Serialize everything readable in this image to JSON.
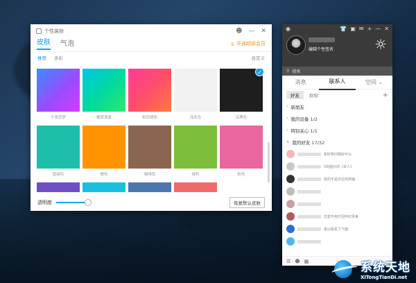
{
  "skin_window": {
    "title": "个性装扮",
    "tabs": [
      {
        "label": "皮肤",
        "active": true
      },
      {
        "label": "气泡",
        "active": false
      }
    ],
    "vip_label": "开通超级会员",
    "subtabs": [
      {
        "label": "推荐",
        "active": true
      },
      {
        "label": "多彩",
        "active": false
      }
    ],
    "custom_label": "自定义",
    "swatches": [
      {
        "label": "千夜恋梦",
        "color": "linear-gradient(135deg,#3b8cff 0%,#9a4bff 55%,#d33cff 100%)",
        "selected": false
      },
      {
        "label": "樱草清香",
        "color": "linear-gradient(135deg,#00c6e6 0%,#00d9a0 50%,#2ee86a 100%)",
        "selected": false
      },
      {
        "label": "粉目晴阳",
        "color": "linear-gradient(135deg,#ff3d9a 0%,#ff4d6a 50%,#ff7a3d 100%)",
        "selected": false
      },
      {
        "label": "浅灰色",
        "color": "#f2f2f2",
        "selected": false
      },
      {
        "label": "深黑色",
        "color": "#1e1e1e",
        "selected": true
      },
      {
        "label": "蓝绿色",
        "color": "#1dbfa9",
        "selected": false
      },
      {
        "label": "橙色",
        "color": "#ff9300",
        "selected": false
      },
      {
        "label": "咖啡色",
        "color": "#8a6650",
        "selected": false
      },
      {
        "label": "绿色",
        "color": "#7dbf3c",
        "selected": false
      },
      {
        "label": "粉色",
        "color": "#e8679e",
        "selected": false
      },
      {
        "label": "",
        "color": "#6e4fc4",
        "selected": false
      },
      {
        "label": "",
        "color": "#18bfe0",
        "selected": false
      },
      {
        "label": "",
        "color": "#4a77b0",
        "selected": false
      },
      {
        "label": "",
        "color": "#f06a6a",
        "selected": false
      }
    ],
    "opacity_label": "透明度",
    "opacity_level": 1.0,
    "reset_label": "恢复默认皮肤"
  },
  "qq_panel": {
    "signature": "编辑个性签名",
    "search_placeholder": "搜索",
    "tabs": [
      {
        "label": "消息",
        "active": false
      },
      {
        "label": "联系人",
        "active": true
      },
      {
        "label": "空间",
        "active": false
      }
    ],
    "subtabs": [
      {
        "label": "好友",
        "active": true
      },
      {
        "label": "群聊",
        "active": false
      }
    ],
    "groups": [
      {
        "label": "新朋友"
      },
      {
        "label": "我的设备 1/2"
      },
      {
        "label": "特别关心 1/1"
      },
      {
        "label": "我的好友 17/32"
      }
    ],
    "friends": [
      {
        "msg": "和好笑问题好可以",
        "color": "#f3b8b8"
      },
      {
        "msg": "5的图片的《本人》",
        "color": "#c9c9c9"
      },
      {
        "msg": "有的不是日过的商铺",
        "color": "#333"
      },
      {
        "msg": "",
        "color": "#bdbdbd"
      },
      {
        "msg": "",
        "color": "#caa0a6"
      },
      {
        "msg": "恋爱不用打招呼红零食",
        "color": "#b35a5a"
      },
      {
        "msg": "金山看看了下面",
        "color": "#2a6fd0"
      },
      {
        "msg": "",
        "color": "#4bb8e8"
      }
    ]
  },
  "watermark": {
    "cn": "系统天地",
    "en": "XiTongTianDi.net"
  },
  "icons": {
    "skin": "shirt-icon",
    "mail": "mail-icon",
    "add": "plus-icon",
    "weather": "sun-icon"
  }
}
